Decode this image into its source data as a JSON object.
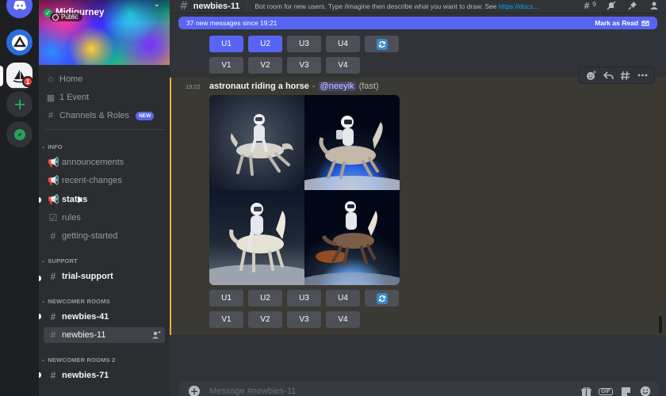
{
  "server": {
    "name": "Midjourney",
    "visibility": "Public",
    "rail_badge": "1"
  },
  "sidebar": {
    "nav": [
      {
        "label": "Home",
        "icon": "home-icon"
      },
      {
        "label": "1 Event",
        "icon": "calendar-icon"
      },
      {
        "label": "Channels & Roles",
        "icon": "channels-roles-icon",
        "badge": "NEW"
      }
    ],
    "categories": {
      "info": "INFO",
      "support": "SUPPORT",
      "newcomer_rooms": "NEWCOMER ROOMS",
      "newcomer_rooms_2": "NEWCOMER ROOMS 2"
    },
    "channels": {
      "announcements": "announcements",
      "recent_changes": "recent-changes",
      "status": "status",
      "rules": "rules",
      "getting_started": "getting-started",
      "trial_support": "trial-support",
      "newbies_41": "newbies-41",
      "newbies_11": "newbies-11",
      "newbies_71": "newbies-71"
    }
  },
  "channel": {
    "name": "newbies-11",
    "topic": "Bot room for new users. Type /imagine then describe what you want to draw. See",
    "topic_link": "https://docs...",
    "thread_count": "9"
  },
  "banner": {
    "new_messages": "37 new messages since 19:21",
    "mark_as_read": "Mark as Read"
  },
  "buttons": {
    "upscale": [
      "U1",
      "U2",
      "U3",
      "U4"
    ],
    "variation": [
      "V1",
      "V2",
      "V3",
      "V4"
    ]
  },
  "message": {
    "time": "19:22",
    "prompt": "astronaut riding a horse",
    "dash": "-",
    "mention": "@neeyik",
    "speed": "(fast)"
  },
  "composer": {
    "placeholder": "Message #newbies-11"
  },
  "colors": {
    "accent": "#5865f2",
    "highlight_border": "#f0b232",
    "unread_badge": "#f23f43",
    "online": "#23a55a"
  }
}
